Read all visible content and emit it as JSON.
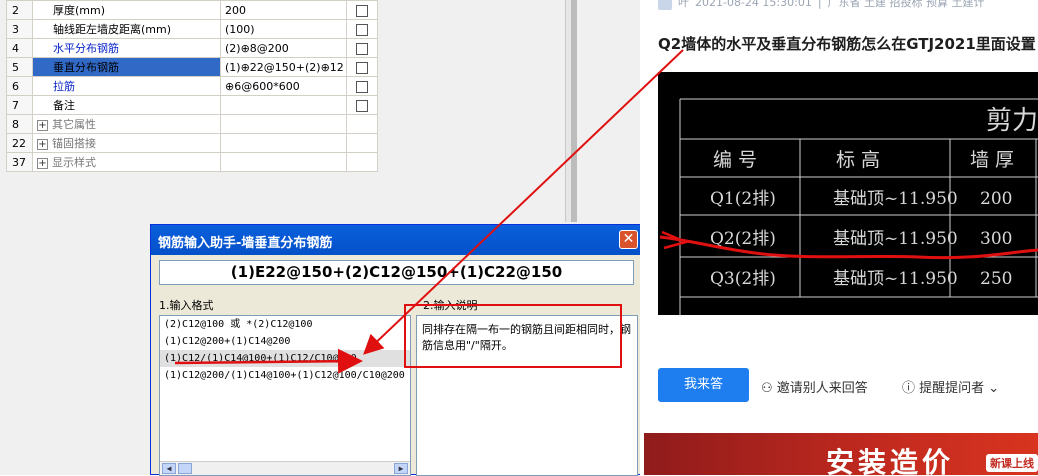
{
  "prop_table": {
    "rows": [
      {
        "num": "2",
        "name": "厚度(mm)",
        "value": "200",
        "checkbox": true
      },
      {
        "num": "3",
        "name": "轴线距左墙皮距离(mm)",
        "value": "(100)",
        "checkbox": true
      },
      {
        "num": "4",
        "name": "水平分布钢筋",
        "value": "(2)⊕8@200",
        "checkbox": true
      },
      {
        "num": "5",
        "name": "垂直分布钢筋",
        "value": "(1)⊕22@150+(2)⊕12",
        "checkbox": true
      },
      {
        "num": "6",
        "name": "拉筋",
        "value": "⊕6@600*600",
        "checkbox": true
      },
      {
        "num": "7",
        "name": "备注",
        "value": "",
        "checkbox": true
      },
      {
        "num": "8",
        "name": "其它属性",
        "value": "",
        "expander": "+"
      },
      {
        "num": "22",
        "name": "锚固搭接",
        "value": "",
        "expander": "+"
      },
      {
        "num": "37",
        "name": "显示样式",
        "value": "",
        "expander": "+"
      }
    ]
  },
  "dialog": {
    "title": "钢筋输入助手-墙垂直分布钢筋",
    "close_glyph": "✕",
    "formula": "(1)E22@150+(2)C12@150+(1)C22@150",
    "format_label": "1.输入格式",
    "description_label": "2.输入说明",
    "formats": [
      "(2)C12@100 或 *(2)C12@100",
      "(1)C12@200+(1)C14@200",
      "(1)C12/(1)C14@100+(1)C12/C10@100",
      "(1)C12@200/(1)C14@100+(1)C12@100/C10@200"
    ],
    "description": "同排存在隔一布一的钢筋且间距相同时，钢筋信息用\"/\"隔开。",
    "scroll_left": "◀",
    "scroll_right": "▶"
  },
  "article": {
    "meta_author": "叶",
    "meta_date": "2021-08-24 15:30:01",
    "meta_sep": "|",
    "meta_tags": "广东省 土建 招投标 预算 土建计",
    "title": "Q2墙体的水平及垂直分布钢筋怎么在GTJ2021里面设置",
    "drawing": {
      "table_title": "剪力墙",
      "headers": [
        "编 号",
        "标 高",
        "墙 厚"
      ],
      "rows": [
        [
          "Q1(2排)",
          "基础顶~11.950",
          "200"
        ],
        [
          "Q2(2排)",
          "基础顶~11.950",
          "300"
        ],
        [
          "Q3(2排)",
          "基础顶~11.950",
          "250"
        ]
      ]
    },
    "answer_button": "我来答",
    "invite": "邀请别人来回答",
    "remind": "提醒提问者",
    "banner": "安装造价",
    "banner_tag": "新课上线"
  },
  "colors": {
    "selection_blue": "#3169c6",
    "link_blue": "#0a24c8",
    "annotation_red": "#e01010",
    "answer_button": "#1e7ef0"
  }
}
